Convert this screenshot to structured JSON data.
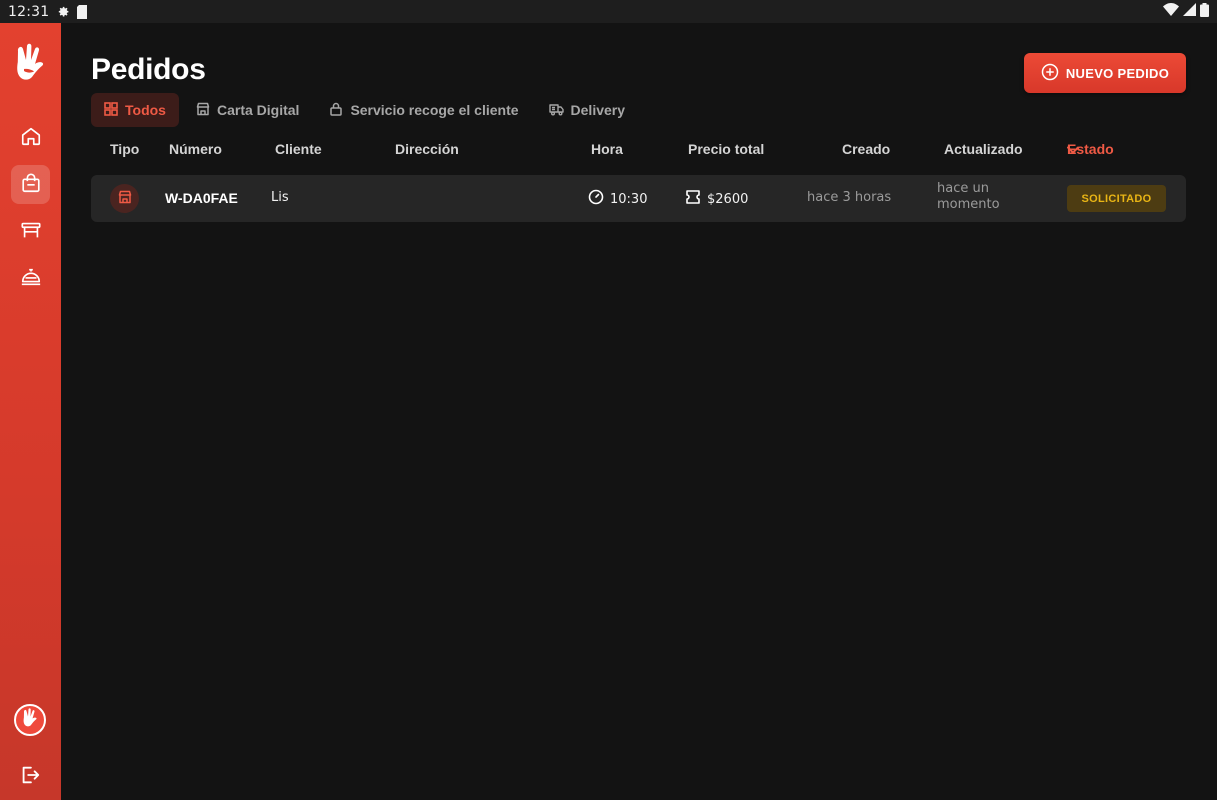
{
  "status_bar": {
    "time": "12:31",
    "left_icons": [
      "gear-icon",
      "sd-card-icon"
    ],
    "right_icons": [
      "wifi-icon",
      "signal-icon",
      "battery-icon"
    ]
  },
  "sidebar": {
    "brand_color": "#e3412f",
    "items": [
      {
        "name": "home",
        "icon": "home-icon",
        "active": false
      },
      {
        "name": "orders",
        "icon": "shopping-bag-icon",
        "active": true
      },
      {
        "name": "tables",
        "icon": "table-icon",
        "active": false
      },
      {
        "name": "service",
        "icon": "cloche-icon",
        "active": false
      }
    ],
    "bottom": {
      "avatar_icon": "hand-logo-icon",
      "logout_icon": "logout-icon"
    }
  },
  "header": {
    "title": "Pedidos",
    "new_order_button": "NUEVO PEDIDO"
  },
  "tabs": [
    {
      "label": "Todos",
      "icon": "grid-icon",
      "active": true
    },
    {
      "label": "Carta Digital",
      "icon": "store-icon",
      "active": false
    },
    {
      "label": "Servicio recoge el cliente",
      "icon": "lock-bag-icon",
      "active": false
    },
    {
      "label": "Delivery",
      "icon": "truck-icon",
      "active": false
    }
  ],
  "table": {
    "columns": {
      "tipo": "Tipo",
      "numero": "Número",
      "cliente": "Cliente",
      "direccion": "Dirección",
      "hora": "Hora",
      "precio_total": "Precio total",
      "creado": "Creado",
      "actualizado": "Actualizado",
      "estado": "Estado"
    },
    "rows": [
      {
        "type_icon": "store-icon",
        "numero": "W-DA0FAE",
        "cliente": "Lis",
        "direccion": "",
        "hora": "10:30",
        "precio_total": "$2600",
        "creado": "hace 3 horas",
        "actualizado": "hace un momento",
        "estado": "SOLICITADO"
      }
    ]
  },
  "colors": {
    "accent": "#ef5a45",
    "background": "#131313",
    "row_background": "#262626",
    "status_solicitado_text": "#e9b515",
    "status_solicitado_bg": "#4d3c12"
  }
}
